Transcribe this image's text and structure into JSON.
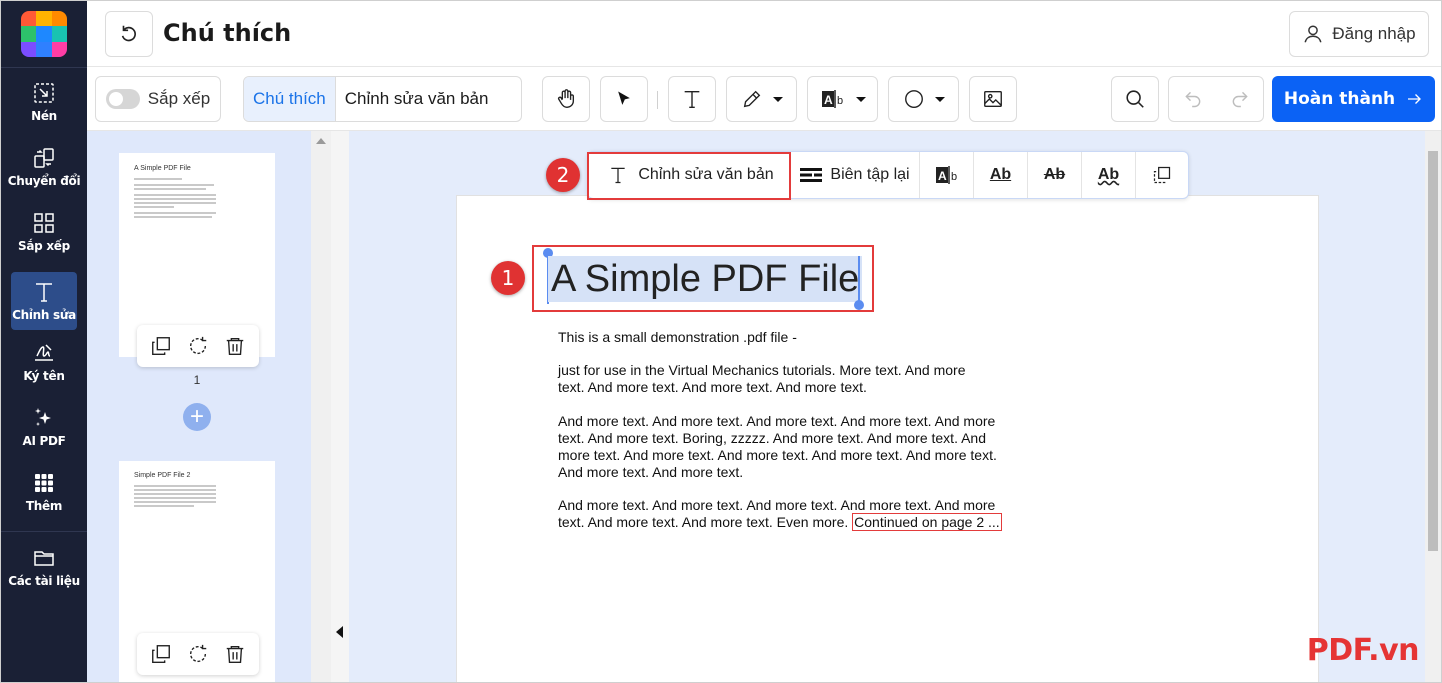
{
  "header": {
    "title": "Chú thích",
    "login_label": "Đăng nhập"
  },
  "rail": {
    "items": [
      {
        "label": "Nén",
        "icon": "compress-icon"
      },
      {
        "label": "Chuyển đổi",
        "icon": "convert-icon"
      },
      {
        "label": "Sắp xếp",
        "icon": "grid-icon"
      },
      {
        "label": "Chỉnh sửa",
        "icon": "text-edit-icon",
        "active": true
      },
      {
        "label": "Ký tên",
        "icon": "signature-icon"
      },
      {
        "label": "AI PDF",
        "icon": "sparkle-icon"
      },
      {
        "label": "Thêm",
        "icon": "dots-grid-icon"
      },
      {
        "label": "Các tài liệu",
        "icon": "folder-icon"
      }
    ]
  },
  "toolbar": {
    "arrange_label": "Sắp xếp",
    "mode_annotate": "Chú thích",
    "mode_edit_text": "Chỉnh sửa văn bản",
    "finish_label": "Hoàn thành"
  },
  "thumbnails": {
    "page1": {
      "title": "A Simple PDF File",
      "number": "1"
    },
    "page2": {
      "title": "Simple PDF File 2"
    }
  },
  "text_toolbar": {
    "edit_text_label": "Chỉnh sửa văn bản",
    "redact_label": "Biên tập lại",
    "ab": "Ab"
  },
  "document": {
    "heading": "A Simple PDF File",
    "paragraphs": [
      "This is a small demonstration .pdf file -",
      "just for use in the Virtual Mechanics tutorials. More text. And more text. And more text. And more text. And more text.",
      "And more text. And more text. And more text. And more text. And more text. And more text. Boring, zzzzz. And more text. And more text. And more text. And more text. And more text. And more text. And more text. And more text. And more text.",
      "And more text. And more text. And more text. And more text. And more text. And more text. And more text. Even more."
    ],
    "continued": "Continued on page 2 ..."
  },
  "badges": {
    "one": "1",
    "two": "2"
  },
  "watermark": "PDF.vn",
  "colors": {
    "rail": "#1a2035",
    "accent": "#0b62f5",
    "highlight": "#e33b3b"
  }
}
